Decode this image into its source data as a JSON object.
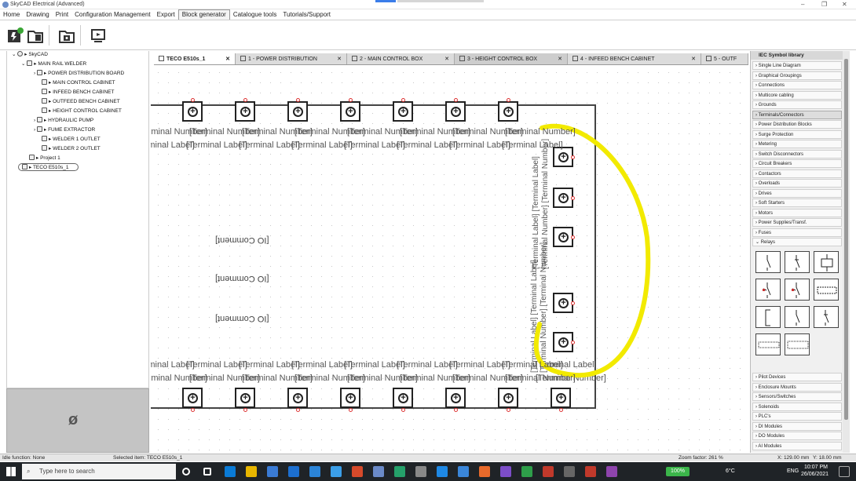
{
  "app": {
    "title": "SkyCAD Electrical (Advanced)"
  },
  "menu": [
    "Home",
    "Drawing",
    "Print",
    "Configuration Management",
    "Export",
    "Block generator",
    "Catalogue tools",
    "Tutorials/Support"
  ],
  "menu_active": "Block generator",
  "tree": {
    "root": "SkyCAD",
    "project": "MAIN RAIL WELDER",
    "items": [
      "POWER DISTRIBUTION BOARD",
      "MAIN CONTROL CABINET",
      "INFEED BENCH CABINET",
      "OUTFEED BENCH CABINET",
      "HEIGHT CONTROL CABINET",
      "HYDRAULIC PUMP",
      "FUME EXTRACTOR",
      "WELDER 1 OUTLET",
      "WELDER 2 OUTLET"
    ],
    "project2": "Project 1",
    "selected": "TECO E510s_1"
  },
  "tabs": [
    {
      "label": "TECO E510s_1",
      "active": true
    },
    {
      "label": "1 - POWER DISTRIBUTION"
    },
    {
      "label": "2 - MAIN CONTROL BOX"
    },
    {
      "label": "3 - HEIGHT CONTROL BOX"
    },
    {
      "label": "4 - INFEED BENCH CABINET"
    },
    {
      "label": "5 - OUTF"
    }
  ],
  "canvas": {
    "top_number": "[Terminal Number]",
    "top_label": "[Terminal Label]",
    "io_comment": "[IO Comment]",
    "right_vertical_1": "[Terminal Label] [Terminal Label]",
    "right_vertical_2": "[Terminal Number] [Terminal Number]",
    "bottom_label_tail": "[Terminal Label]",
    "bottom_number_tail": "[Terminal Number]"
  },
  "library": {
    "title": "IEC Symbol library",
    "top_items": [
      "Single Line Diagram",
      "Graphical Groupings",
      "Connections",
      "Multicore cabling",
      "Grounds",
      "Terminals/Connectors",
      "Power Distribution Blocks",
      "Surge Protection",
      "Metering",
      "Switch Disconnectors",
      "Circuit Breakers",
      "Contactors",
      "Overloads",
      "Drives",
      "Soft Starters",
      "Motors",
      "Power Supplies/Transf.",
      "Fuses",
      "Relays"
    ],
    "bottom_items": [
      "Pilot Devices",
      "Enclosure Mounts",
      "Sensors/Switches",
      "Solenoids",
      "PLC's",
      "DI Modules",
      "DO Modules",
      "AI Modules"
    ]
  },
  "status": {
    "function": "Idle function: None",
    "selected": "Selected item: TECO E510s_1",
    "zoom": "Zoom factor: 261 %",
    "x": "X: 129.00 mm",
    "y": "Y: 18.00 mm"
  },
  "taskbar": {
    "search_placeholder": "Type here to search",
    "battery": "100%",
    "weather": "6°C",
    "lang": "ENG",
    "time": "10:07 PM",
    "date": "26/06/2021"
  },
  "colors": {
    "highlight": "#f2ea00",
    "pin": "#dd3333"
  }
}
